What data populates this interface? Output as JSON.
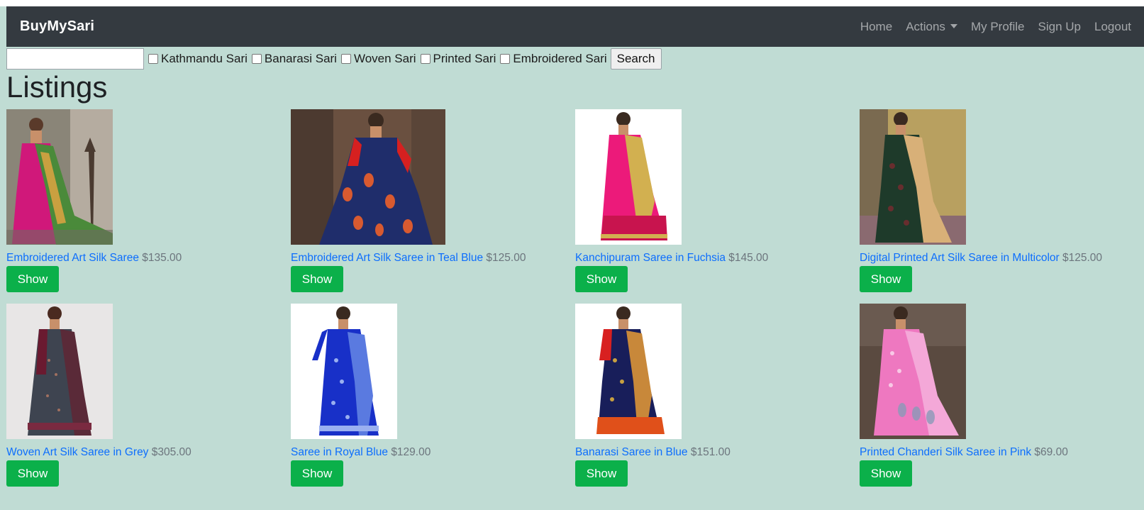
{
  "navbar": {
    "brand": "BuyMySari",
    "links": [
      {
        "label": "Home"
      },
      {
        "label": "Actions"
      },
      {
        "label": "My Profile"
      },
      {
        "label": "Sign Up"
      },
      {
        "label": "Logout"
      }
    ]
  },
  "search": {
    "value": "",
    "placeholder": "",
    "filters": [
      {
        "label": "Kathmandu Sari",
        "checked": false
      },
      {
        "label": "Banarasi Sari",
        "checked": false
      },
      {
        "label": "Woven Sari",
        "checked": false
      },
      {
        "label": "Printed Sari",
        "checked": false
      },
      {
        "label": "Embroidered Sari",
        "checked": false
      }
    ],
    "button_label": "Search"
  },
  "page": {
    "title": "Listings"
  },
  "listings": [
    {
      "title": "Embroidered Art Silk Saree",
      "price": "$135.00",
      "button": "Show",
      "image": "saree-magenta-green"
    },
    {
      "title": "Embroidered Art Silk Saree in Teal Blue",
      "price": "$125.00",
      "button": "Show",
      "image": "saree-navy-red"
    },
    {
      "title": "Kanchipuram Saree in Fuchsia",
      "price": "$145.00",
      "button": "Show",
      "image": "saree-fuchsia-gold"
    },
    {
      "title": "Digital Printed Art Silk Saree in Multicolor",
      "price": "$125.00",
      "button": "Show",
      "image": "saree-dark-multicolor"
    },
    {
      "title": "Woven Art Silk Saree in Grey",
      "price": "$305.00",
      "button": "Show",
      "image": "saree-grey-maroon"
    },
    {
      "title": "Saree in Royal Blue",
      "price": "$129.00",
      "button": "Show",
      "image": "saree-royal-blue"
    },
    {
      "title": "Banarasi Saree in Blue",
      "price": "$151.00",
      "button": "Show",
      "image": "saree-navy-orange"
    },
    {
      "title": "Printed Chanderi Silk Saree in Pink",
      "price": "$69.00",
      "button": "Show",
      "image": "saree-pink-print"
    }
  ]
}
